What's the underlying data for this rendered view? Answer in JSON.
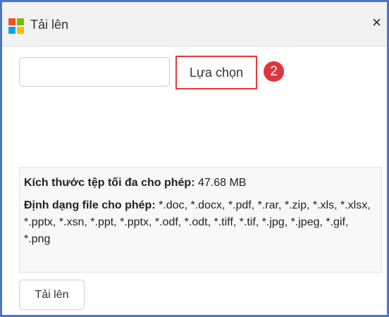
{
  "dialog": {
    "title": "Tải lên",
    "close_label": "×"
  },
  "upload": {
    "file_value": "",
    "choose_label": "Lựa chọn",
    "step_badge": "2"
  },
  "info": {
    "max_size_label": "Kích thước tệp tối đa cho phép:",
    "max_size_value": "47.68 MB",
    "formats_label": "Định dạng file cho phép:",
    "formats_value": "*.doc, *.docx, *.pdf, *.rar, *.zip, *.xls, *.xlsx, *.pptx, *.xsn, *.ppt, *.pptx, *.odf, *.odt, *.tiff, *.tif, *.jpg, *.jpeg, *.gif, *.png"
  },
  "footer": {
    "upload_label": "Tải lên"
  },
  "colors": {
    "frame_border": "#4a78c2",
    "highlight": "#e4383f"
  }
}
